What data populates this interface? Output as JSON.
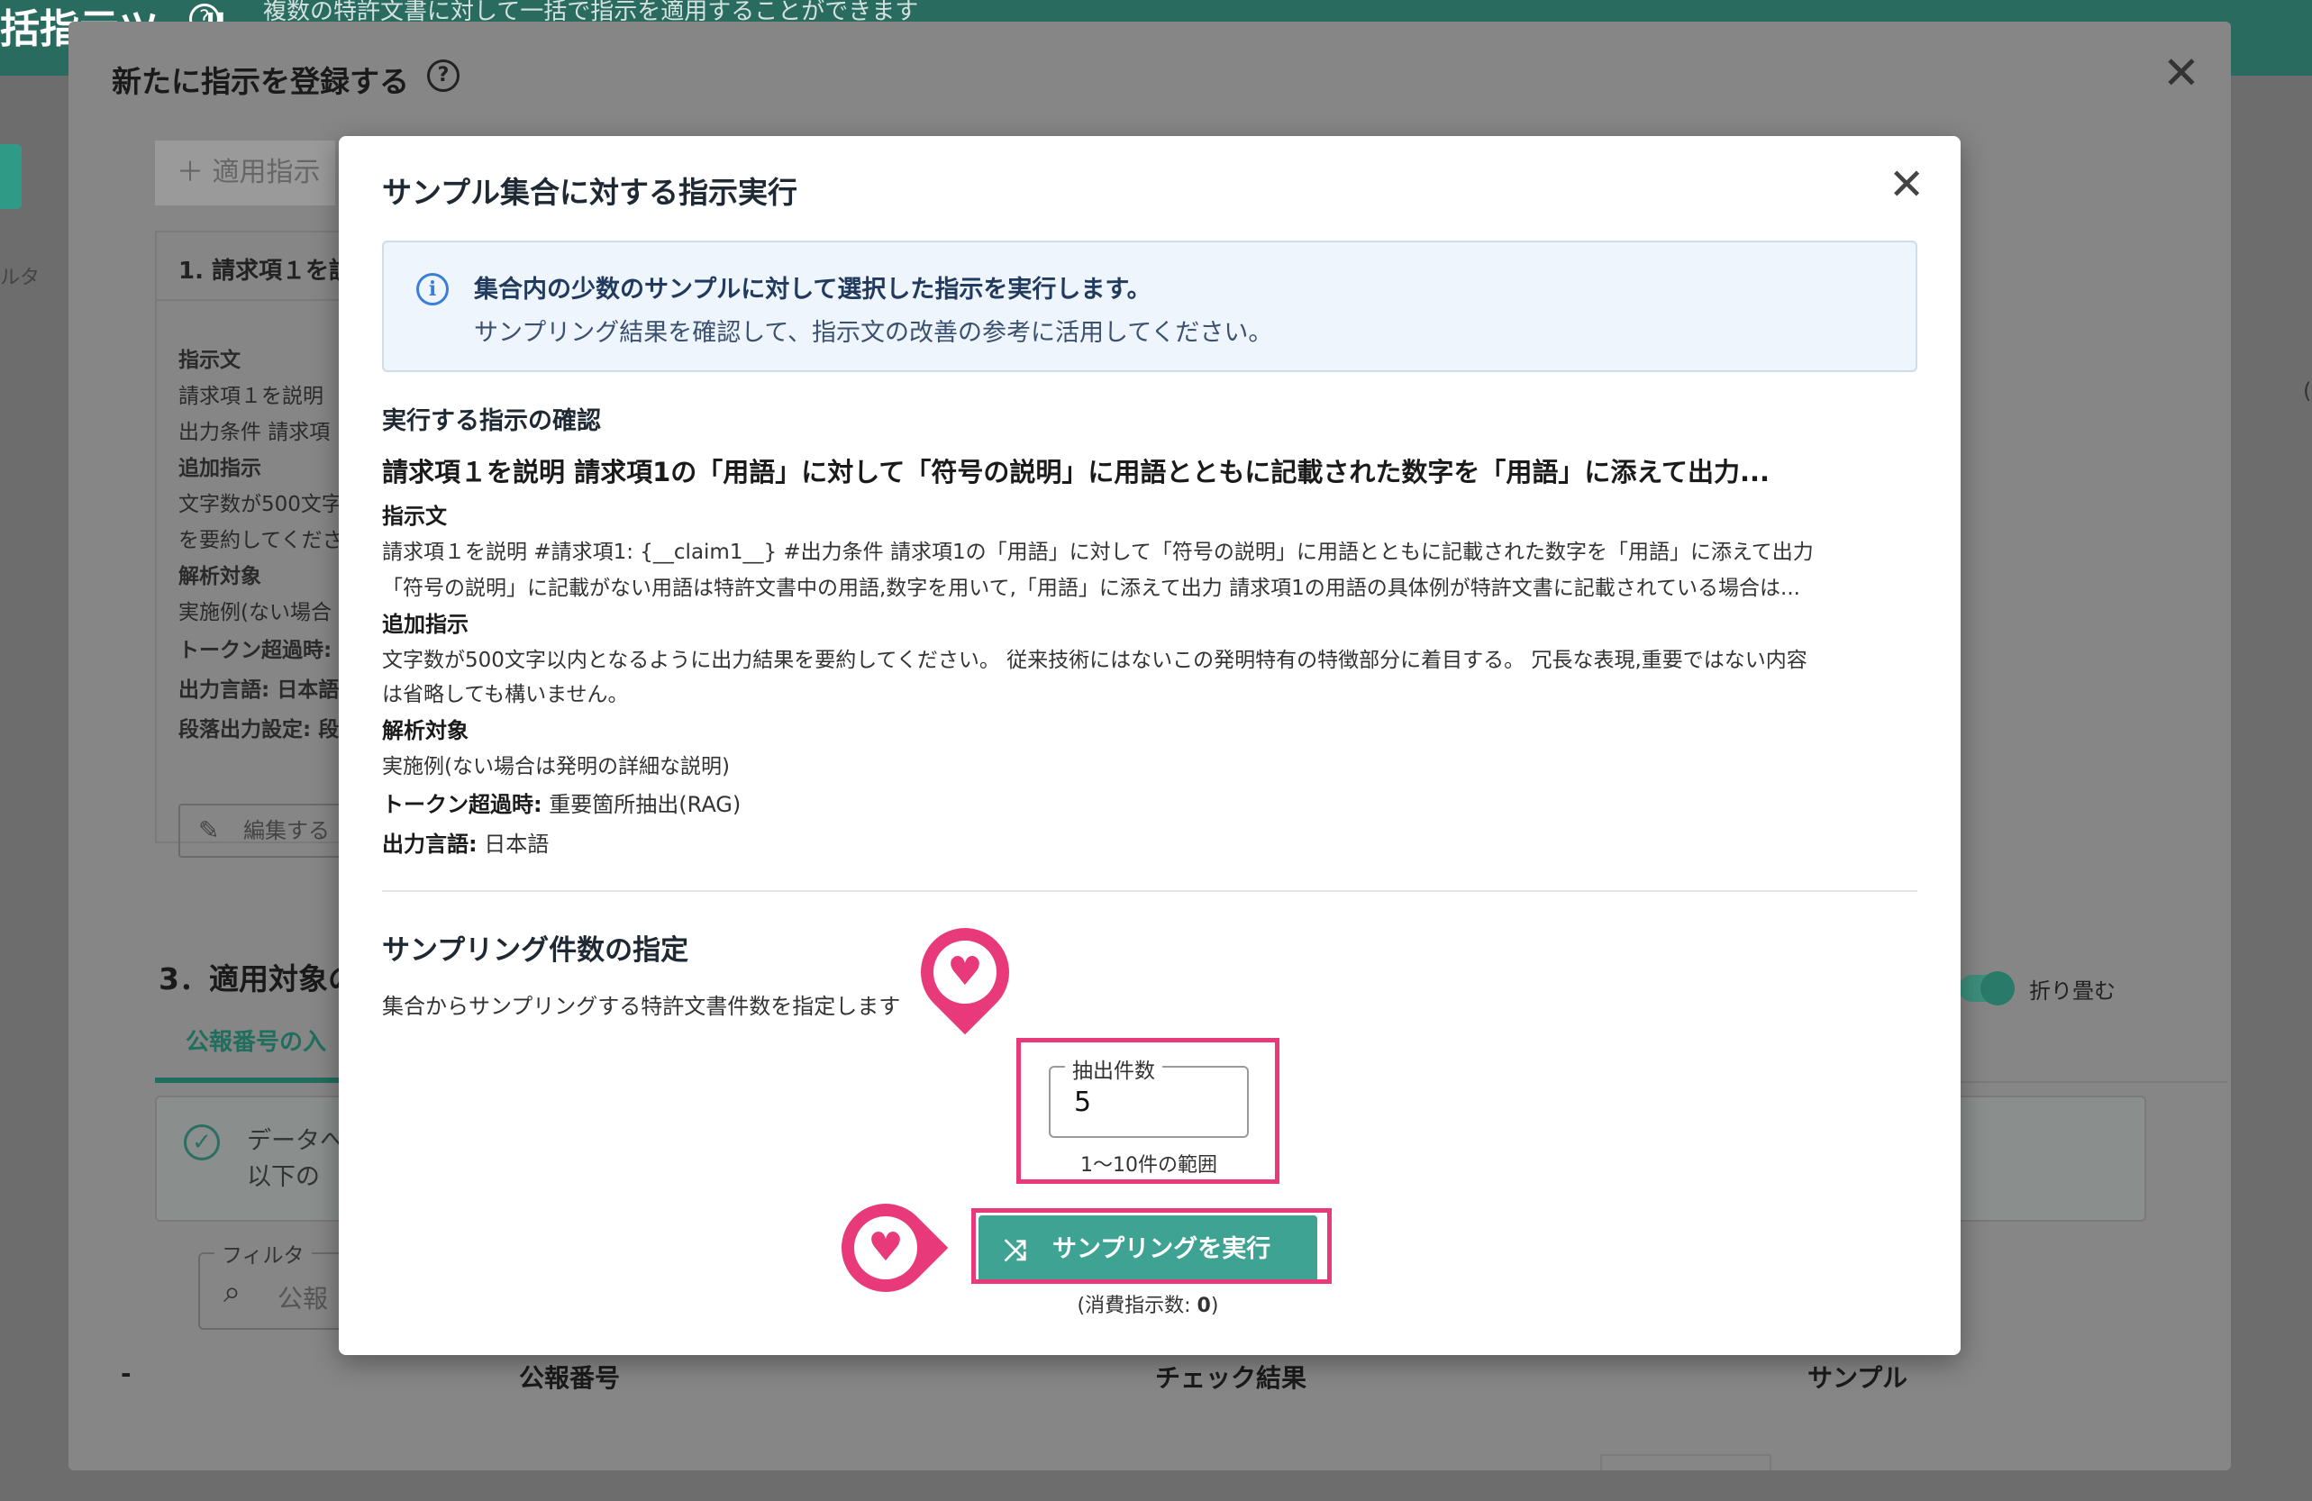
{
  "app": {
    "tool_title": "括指示ツール",
    "tool_subtitle": "複数の特許文書に対して一括で指示を適用することができます",
    "help_glyph": "?",
    "side_label": "ルタ"
  },
  "outer_dialog": {
    "title": "新たに指示を登録する",
    "help_glyph": "?",
    "close_glyph": "✕",
    "add_button": "＋ 適用指示",
    "card": {
      "header": "1. 請求項１を説",
      "lines": [
        {
          "text": "指示文",
          "bold": true
        },
        {
          "text": "請求項１を説明",
          "bold": false
        },
        {
          "text": "出力条件 請求項",
          "bold": false
        },
        {
          "text": "追加指示",
          "bold": true
        },
        {
          "text": "文字数が500文字",
          "bold": false
        },
        {
          "text": "を要約してくださ",
          "bold": false
        },
        {
          "text": "解析対象",
          "bold": true
        },
        {
          "text": "実施例(ない場合",
          "bold": false
        },
        {
          "text": "トークン超過時:",
          "bold": true
        },
        {
          "text": "出力言語: 日本語",
          "bold": true
        },
        {
          "text": "段落出力設定: 段",
          "bold": true
        }
      ],
      "edit_button": "編集する"
    },
    "section3_title": "3．適用対象の",
    "tab_label": "公報番号の入",
    "alert_line1": "データへ",
    "alert_line2": "以下の",
    "filter_label": "フィルタ",
    "filter_placeholder": "公報",
    "table_headers": [
      "-",
      "公報番号",
      "チェック結果",
      "サンプル"
    ],
    "fold_label": "折り畳む"
  },
  "modal": {
    "title": "サンプル集合に対する指示実行",
    "close_glyph": "✕",
    "info": {
      "icon": "info-icon",
      "line1": "集合内の少数のサンプルに対して選択した指示を実行します。",
      "line2": "サンプリング結果を確認して、指示文の改善の参考に活用してください。"
    },
    "confirm_section_title": "実行する指示の確認",
    "instruction_title": "請求項１を説明 請求項1の「用語」に対して「符号の説明」に用語とともに記載された数字を「用語」に添えて出力...",
    "instruction_label": "指示文",
    "instruction_line1": "請求項１を説明 #請求項1: {__claim1__} #出力条件 請求項1の「用語」に対して「符号の説明」に用語とともに記載された数字を「用語」に添えて出力",
    "instruction_line2": "「符号の説明」に記載がない用語は特許文書中の用語,数字を用いて,「用語」に添えて出力 請求項1の用語の具体例が特許文書に記載されている場合は...",
    "additional_label": "追加指示",
    "additional_line1": "文字数が500文字以内となるように出力結果を要約してください。 従来技術にはないこの発明特有の特徴部分に着目する。 冗長な表現,重要ではない内容",
    "additional_line2": "は省略しても構いません。",
    "target_label": "解析対象",
    "target_value": "実施例(ない場合は発明の詳細な説明)",
    "token_label": "トークン超過時:",
    "token_value": "重要箇所抽出(RAG)",
    "lang_label": "出力言語:",
    "lang_value": "日本語",
    "sampling_title": "サンプリング件数の指定",
    "sampling_desc": "集合からサンプリングする特許文書件数を指定します",
    "count_label": "抽出件数",
    "count_value": "5",
    "count_help": "1〜10件の範囲",
    "run_button": "サンプリングを実行",
    "consume_prefix": "(消費指示数: ",
    "consume_count": "0",
    "consume_suffix": ")"
  },
  "annotations": {
    "highlight_color": "#e8397a",
    "pin_icon": "heart-icon"
  },
  "colors": {
    "accent": "#3fa394",
    "info_bg": "#eef5fc",
    "info_icon": "#3b7dd8"
  }
}
